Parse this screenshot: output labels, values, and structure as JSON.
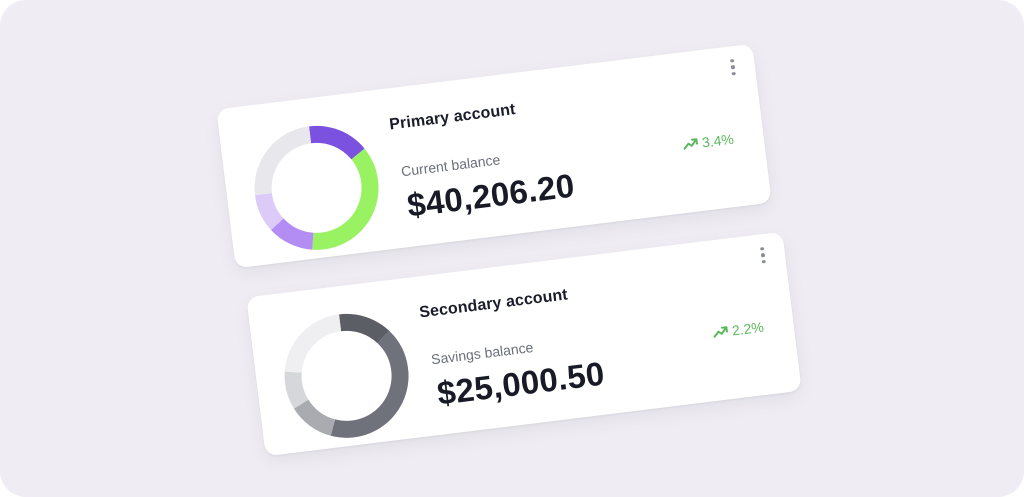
{
  "accounts": [
    {
      "title": "Primary account",
      "balance_label": "Current balance",
      "balance": "$40,206.20",
      "change": "3.4%",
      "change_color": "#5cb85c",
      "menu_icon": "more-vertical-icon",
      "trend_icon": "trend-up-icon",
      "donut_segments": [
        {
          "fraction": 0.16,
          "color": "#7b52df"
        },
        {
          "fraction": 0.37,
          "color": "#98f261"
        },
        {
          "fraction": 0.12,
          "color": "#b48df4"
        },
        {
          "fraction": 0.1,
          "color": "#dccbf9"
        },
        {
          "fraction": 0.25,
          "color": "#e8e8ec"
        }
      ]
    },
    {
      "title": "Secondary account",
      "balance_label": "Savings balance",
      "balance": "$25,000.50",
      "change": "2.2%",
      "change_color": "#5cb85c",
      "menu_icon": "more-vertical-icon",
      "trend_icon": "trend-up-icon",
      "donut_segments": [
        {
          "fraction": 0.14,
          "color": "#5c5e66"
        },
        {
          "fraction": 0.42,
          "color": "#6f727b"
        },
        {
          "fraction": 0.12,
          "color": "#a9abb1"
        },
        {
          "fraction": 0.1,
          "color": "#d6d7db"
        },
        {
          "fraction": 0.22,
          "color": "#efeff1"
        }
      ]
    }
  ]
}
